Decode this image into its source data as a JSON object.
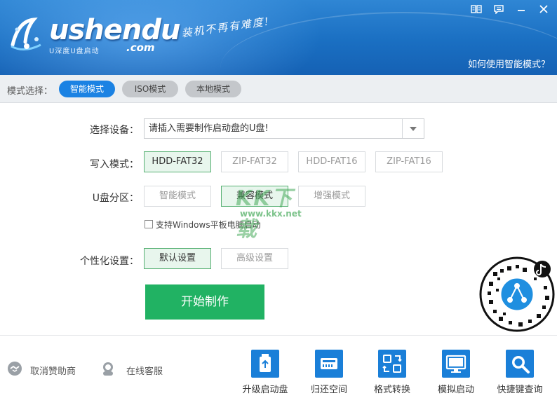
{
  "header": {
    "logo_text": "ushendu",
    "logo_sub": "U深度U盘启动",
    "logo_com": ".com",
    "slogan": "装机不再有难度!",
    "help_link": "如何使用智能模式？",
    "controls": [
      {
        "name": "manual-icon",
        "glyph": "📖"
      },
      {
        "name": "message-icon",
        "glyph": "▭"
      },
      {
        "name": "minimize-icon",
        "glyph": "—"
      },
      {
        "name": "close-icon",
        "glyph": "✕"
      }
    ]
  },
  "modebar": {
    "label": "模式选择：",
    "modes": [
      {
        "label": "智能模式",
        "active": true
      },
      {
        "label": "ISO模式",
        "active": false
      },
      {
        "label": "本地模式",
        "active": false
      }
    ]
  },
  "form": {
    "device_label": "选择设备：",
    "device_value": "请插入需要制作启动盘的U盘!",
    "write_label": "写入模式：",
    "write_options": [
      {
        "label": "HDD-FAT32",
        "selected": true
      },
      {
        "label": "ZIP-FAT32",
        "selected": false
      },
      {
        "label": "HDD-FAT16",
        "selected": false
      },
      {
        "label": "ZIP-FAT16",
        "selected": false
      }
    ],
    "partition_label": "U盘分区：",
    "partition_options": [
      {
        "label": "智能模式",
        "selected": false
      },
      {
        "label": "兼容模式",
        "selected": true
      },
      {
        "label": "增强模式",
        "selected": false
      }
    ],
    "tablet_checkbox_label": "支持Windows平板电脑启动",
    "tablet_checked": false,
    "personal_label": "个性化设置：",
    "personal_options": [
      {
        "label": "默认设置",
        "selected": true
      },
      {
        "label": "高级设置",
        "selected": false
      }
    ],
    "start_button": "开始制作"
  },
  "watermark": {
    "text": "KK下载",
    "url": "www.kkx.net"
  },
  "bottom": {
    "sponsor_link": "取消赞助商",
    "support_link": "在线客服",
    "tools": [
      {
        "label": "升级启动盘",
        "icon": "upgrade-icon"
      },
      {
        "label": "归还空间",
        "icon": "drive-icon"
      },
      {
        "label": "格式转换",
        "icon": "convert-icon"
      },
      {
        "label": "模拟启动",
        "icon": "monitor-icon"
      },
      {
        "label": "快捷键查询",
        "icon": "search-icon"
      }
    ]
  },
  "colors": {
    "header_blue": "#1a6fc2",
    "mode_active": "#1b82e3",
    "start_green": "#21b263",
    "tool_blue": "#1a7fd8"
  }
}
